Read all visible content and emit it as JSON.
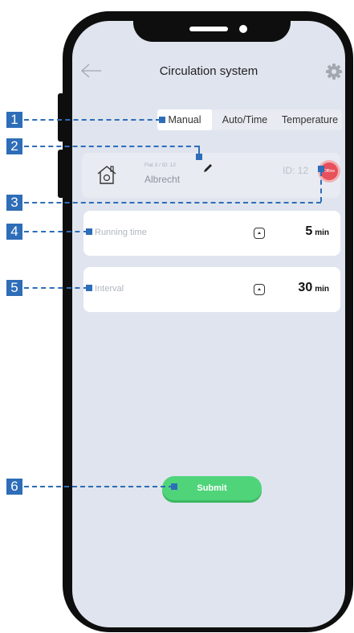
{
  "header": {
    "title": "Circulation system"
  },
  "tabs": [
    {
      "label": "Manual",
      "active": true
    },
    {
      "label": "Auto/Time",
      "active": false
    },
    {
      "label": "Temperature",
      "active": false
    }
  ],
  "device": {
    "subtitle": "Flat 3 / ID: 12",
    "name": "Albrecht",
    "id_text": "ID: 12",
    "status": "Offline"
  },
  "params": [
    {
      "label": "Running time",
      "value": "5",
      "unit": "min"
    },
    {
      "label": "Interval",
      "value": "30",
      "unit": "min"
    }
  ],
  "submit_label": "Submit",
  "callouts": [
    "1",
    "2",
    "3",
    "4",
    "5",
    "6"
  ],
  "colors": {
    "callout": "#2e6db8",
    "submit": "#4fd47a",
    "offline": "#e8505b",
    "screen_bg": "#dfe4ee"
  }
}
